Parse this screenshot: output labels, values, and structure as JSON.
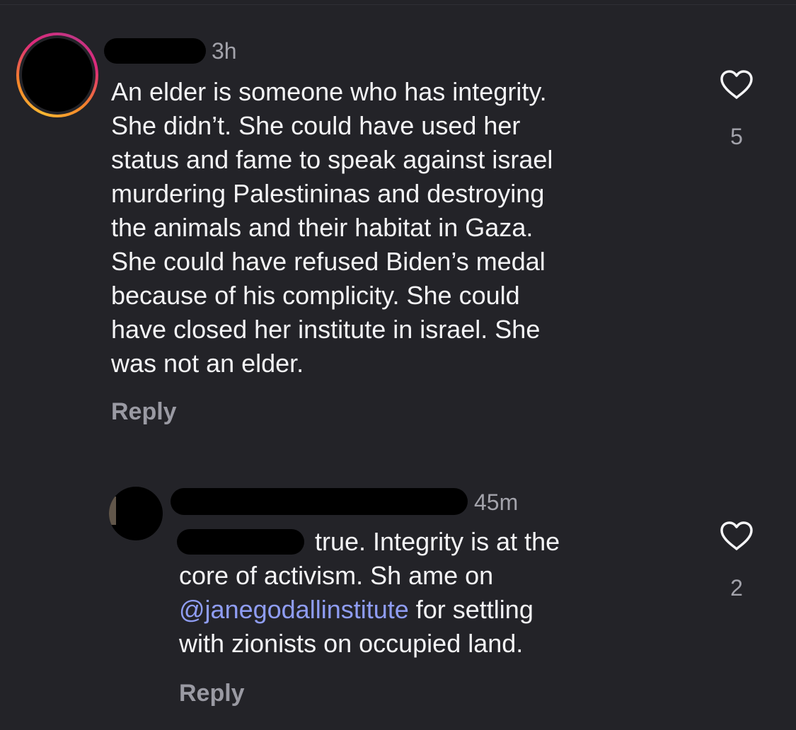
{
  "comments": [
    {
      "timestamp": "3h",
      "lines": [
        "An elder is someone who has integrity.",
        "She didn’t. She could have used her",
        "status and fame to speak against israel",
        "murdering Palestininas and destroying",
        "the animals and their habitat in Gaza.",
        "She could have refused Biden’s medal",
        "because of his complicity. She could",
        "have closed her institute in israel. She",
        "was not an elder."
      ],
      "reply_label": "Reply",
      "like_count": "5",
      "like_icon": "heart-outline-icon"
    },
    {
      "timestamp": "45m",
      "line1_rest": "true. Integrity is at the",
      "line2": "core of activism. Sh ame on",
      "mention": "@janegodallinstitute",
      "line3_rest": " for settling",
      "line4": "with zionists on occupied land.",
      "reply_label": "Reply",
      "like_count": "2",
      "like_icon": "heart-outline-icon"
    }
  ],
  "colors": {
    "background": "#232328",
    "text": "#f4f4f6",
    "muted": "#a3a3ab",
    "mention": "#8f9df4"
  }
}
